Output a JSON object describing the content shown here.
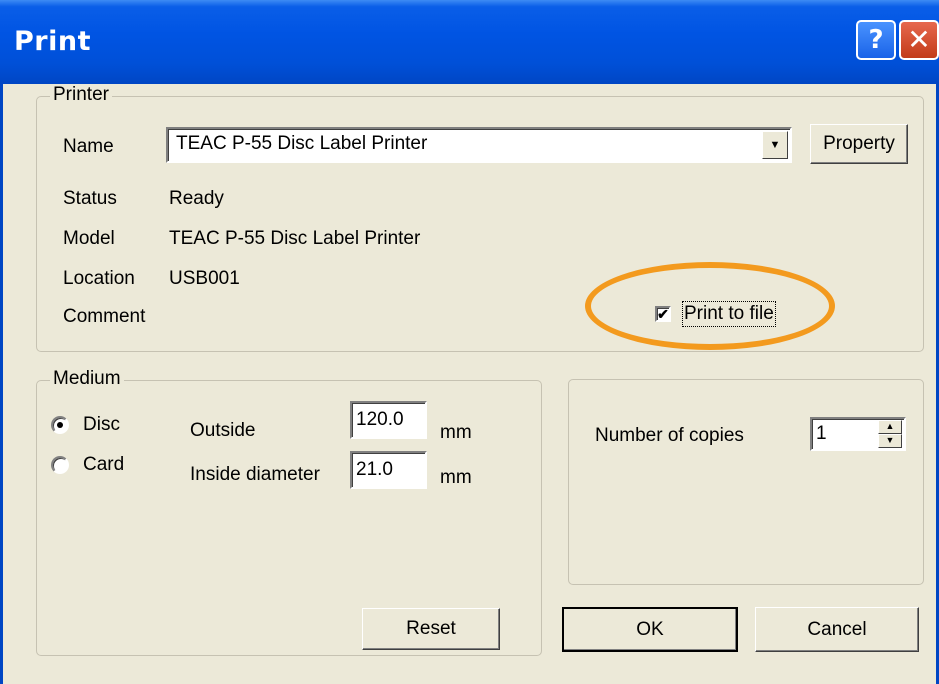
{
  "title_bar": {
    "title": "Print",
    "help_label": "?",
    "close_label": "✕"
  },
  "printer": {
    "group_label": "Printer",
    "name_label": "Name",
    "name_value": "TEAC P-55 Disc Label Printer",
    "property_label": "Property",
    "status_label": "Status",
    "status_value": "Ready",
    "model_label": "Model",
    "model_value": "TEAC P-55 Disc Label Printer",
    "location_label": "Location",
    "location_value": "USB001",
    "comment_label": "Comment",
    "print_to_file_label": "Print to file",
    "print_to_file_checked": true
  },
  "medium": {
    "group_label": "Medium",
    "disc_label": "Disc",
    "card_label": "Card",
    "selected": "Disc",
    "outside_label": "Outside",
    "outside_value": "120.0",
    "inside_label": "Inside diameter",
    "inside_value": "21.0",
    "unit": "mm",
    "reset_label": "Reset"
  },
  "copies": {
    "label": "Number of copies",
    "value": "1"
  },
  "footer": {
    "ok_label": "OK",
    "cancel_label": "Cancel"
  },
  "colors": {
    "title_bar": "#0054e3",
    "highlight": "#f39a1e",
    "dialog_bg": "#ece9d8"
  }
}
